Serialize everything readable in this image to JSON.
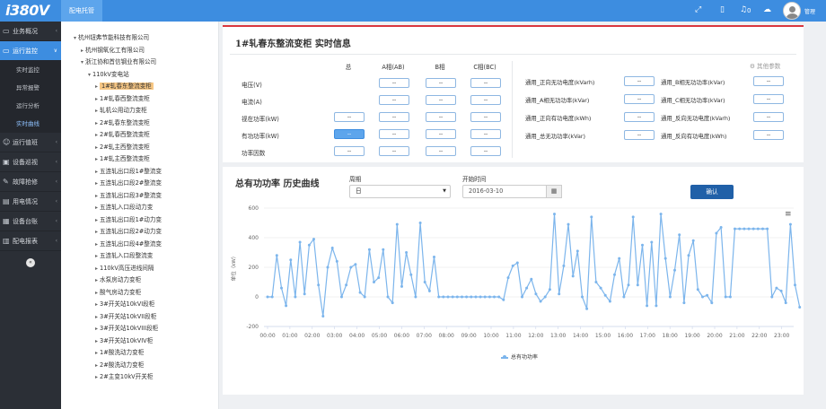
{
  "app": {
    "logo": "i380V",
    "active_tab": "配电托管",
    "user": "管理",
    "notify_count": "0"
  },
  "sidebar": {
    "items": [
      {
        "label": "业务概况",
        "icon": "monitor-icon",
        "chevron": "‹"
      },
      {
        "label": "运行监控",
        "icon": "monitor-icon",
        "chevron": "∨",
        "active": true
      }
    ],
    "sub_items": [
      {
        "label": "实时监控"
      },
      {
        "label": "异常报警"
      },
      {
        "label": "运行分析"
      },
      {
        "label": "实时曲线",
        "active": true
      }
    ],
    "items2": [
      {
        "label": "运行值班",
        "icon": "user-icon",
        "chevron": "‹"
      },
      {
        "label": "设备巡视",
        "icon": "desktop-icon",
        "chevron": "‹"
      },
      {
        "label": "故障抢修",
        "icon": "wrench-icon",
        "chevron": "‹"
      },
      {
        "label": "用电情况",
        "icon": "chart-icon",
        "chevron": "‹"
      },
      {
        "label": "设备台账",
        "icon": "grid-icon",
        "chevron": "‹"
      },
      {
        "label": "配电报表",
        "icon": "report-icon",
        "chevron": "‹"
      }
    ],
    "collapse": "«"
  },
  "tree": {
    "nodes": [
      {
        "label": "杭州钮弗节能科技有限公司",
        "indent": 0,
        "twist": "▾"
      },
      {
        "label": "杭州钢氧化工有限公司",
        "indent": 1,
        "twist": "▸"
      },
      {
        "label": "浙江协和首信钢业有限公司",
        "indent": 1,
        "twist": "▾"
      },
      {
        "label": "110kV变电站",
        "indent": 2,
        "twist": "▾"
      },
      {
        "label": "1#轧春东整流变柜",
        "indent": 3,
        "twist": "▸",
        "selected": true
      },
      {
        "label": "1#轧春西整流变柜",
        "indent": 3,
        "twist": "▸"
      },
      {
        "label": "轧机公用动力变柜",
        "indent": 3,
        "twist": "▸"
      },
      {
        "label": "2#轧春东整流变柜",
        "indent": 3,
        "twist": "▸"
      },
      {
        "label": "2#轧春西整流变柜",
        "indent": 3,
        "twist": "▸"
      },
      {
        "label": "2#轧主西整流变柜",
        "indent": 3,
        "twist": "▸"
      },
      {
        "label": "1#轧主西整流变柜",
        "indent": 3,
        "twist": "▸"
      },
      {
        "label": "五连轧出口段1#整流变",
        "indent": 3,
        "twist": "▸"
      },
      {
        "label": "五连轧出口段2#整流变",
        "indent": 3,
        "twist": "▸"
      },
      {
        "label": "五连轧出口段3#整流变",
        "indent": 3,
        "twist": "▸"
      },
      {
        "label": "五连轧入口段动力变",
        "indent": 3,
        "twist": "▸"
      },
      {
        "label": "五连轧出口段1#动力变",
        "indent": 3,
        "twist": "▸"
      },
      {
        "label": "五连轧出口段2#动力变",
        "indent": 3,
        "twist": "▸"
      },
      {
        "label": "五连轧出口段4#整流变",
        "indent": 3,
        "twist": "▸"
      },
      {
        "label": "五连轧入口段整流变",
        "indent": 3,
        "twist": "▸"
      },
      {
        "label": "110kV高压进线间隔",
        "indent": 3,
        "twist": "▸"
      },
      {
        "label": "水泵房动力变柜",
        "indent": 3,
        "twist": "▸"
      },
      {
        "label": "酸气房动力变柜",
        "indent": 3,
        "twist": "▸"
      },
      {
        "label": "3#开关站10kVI段柜",
        "indent": 3,
        "twist": "▸"
      },
      {
        "label": "3#开关站10kVII段柜",
        "indent": 3,
        "twist": "▸"
      },
      {
        "label": "3#开关站10kVIII段柜",
        "indent": 3,
        "twist": "▸"
      },
      {
        "label": "3#开关站10kVIV柜",
        "indent": 3,
        "twist": "▸"
      },
      {
        "label": "1#酸洗动力变柜",
        "indent": 3,
        "twist": "▸"
      },
      {
        "label": "2#酸洗动力变柜",
        "indent": 3,
        "twist": "▸"
      },
      {
        "label": "2#主变10kV开关柜",
        "indent": 3,
        "twist": "▸"
      }
    ]
  },
  "realtime": {
    "title": "1#轧春东整流变柜 实时信息",
    "col_heads": [
      "总",
      "A相(AB)",
      "B相",
      "C相(BC)"
    ],
    "rows": [
      {
        "label": "电压(V)",
        "values": [
          null,
          "--",
          "--",
          "--"
        ]
      },
      {
        "label": "电流(A)",
        "values": [
          null,
          "--",
          "--",
          "--"
        ]
      },
      {
        "label": "视在功率(kW)",
        "values": [
          "--",
          "--",
          "--",
          "--"
        ]
      },
      {
        "label": "有功功率(kW)",
        "values": [
          "--",
          "--",
          "--",
          "--"
        ],
        "highlight_first": true
      },
      {
        "label": "功率因数",
        "values": [
          "--",
          "--",
          "--",
          "--"
        ]
      }
    ],
    "more_params": "⚙ 其他参数",
    "right_left": [
      {
        "label": "通用_正向无功电度(kVarh)",
        "value": "--"
      },
      {
        "label": "通用_A相无功功率(kVar)",
        "value": "--"
      },
      {
        "label": "通用_正向有功电度(kWh)",
        "value": "--"
      },
      {
        "label": "通用_总无功功率(kVar)",
        "value": "--"
      }
    ],
    "right_right": [
      {
        "label": "通用_B相无功功率(kVar)",
        "value": "--"
      },
      {
        "label": "通用_C相无功功率(kVar)",
        "value": "--"
      },
      {
        "label": "通用_反向无功电度(kVarh)",
        "value": "--"
      },
      {
        "label": "通用_反向有功电度(kWh)",
        "value": "--"
      }
    ]
  },
  "history": {
    "title": "总有功功率 历史曲线",
    "period_label": "周期",
    "period_value": "日",
    "start_label": "开始时间",
    "start_value": "2016-03-10",
    "ok_label": "确认",
    "chart_data": {
      "type": "line",
      "ylabel": "单位（kW）",
      "ylim": [
        -200,
        600
      ],
      "y_ticks": [
        600,
        400,
        200,
        0,
        -200
      ],
      "x_ticks": [
        "00:00",
        "01:00",
        "02:00",
        "03:00",
        "04:00",
        "05:00",
        "06:00",
        "07:00",
        "08:00",
        "09:00",
        "10:00",
        "11:00",
        "12:00",
        "13:00",
        "14:00",
        "15:00",
        "16:00",
        "17:00",
        "18:00",
        "19:00",
        "20:00",
        "21:00",
        "22:00",
        "23:00"
      ],
      "series": [
        {
          "name": "总有功功率",
          "values": [
            0,
            0,
            280,
            60,
            -60,
            250,
            0,
            370,
            20,
            350,
            390,
            80,
            -130,
            200,
            330,
            240,
            0,
            80,
            200,
            220,
            30,
            0,
            320,
            100,
            130,
            320,
            0,
            -40,
            490,
            70,
            300,
            150,
            0,
            500,
            100,
            40,
            270,
            0,
            0,
            0,
            0,
            0,
            0,
            0,
            0,
            0,
            0,
            0,
            0,
            0,
            0,
            -20,
            130,
            210,
            230,
            0,
            60,
            120,
            20,
            -30,
            0,
            50,
            560,
            20,
            210,
            490,
            140,
            310,
            0,
            -80,
            540,
            100,
            60,
            10,
            -30,
            150,
            260,
            0,
            80,
            540,
            80,
            350,
            -60,
            370,
            -60,
            560,
            260,
            0,
            180,
            420,
            -40,
            280,
            380,
            50,
            0,
            10,
            -40,
            430,
            470,
            0,
            0,
            460,
            460,
            460,
            460,
            460,
            460,
            460,
            460,
            0,
            60,
            40,
            -40,
            490,
            80,
            -70
          ]
        }
      ]
    }
  }
}
